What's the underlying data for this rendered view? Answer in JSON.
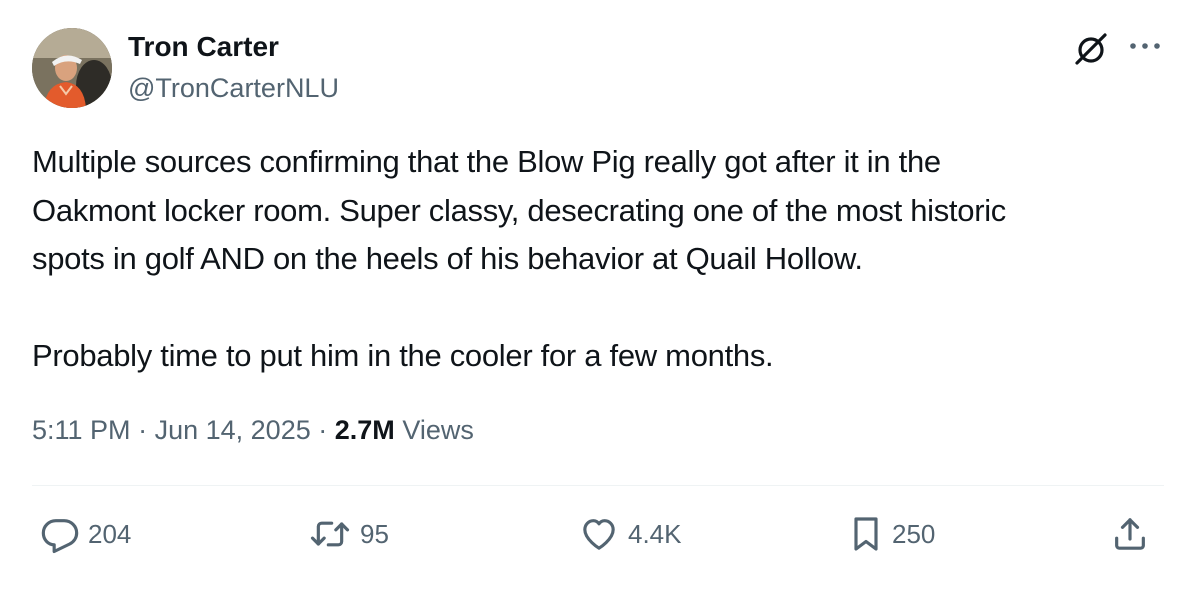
{
  "author": {
    "display_name": "Tron Carter",
    "handle": "@TronCarterNLU",
    "avatar_icon": "profile-photo-golfer"
  },
  "header_icons": {
    "grok": "grok-icon",
    "more": "more-options-icon"
  },
  "tweet": {
    "lines": [
      "Multiple sources confirming that the Blow Pig really got after it in the",
      "Oakmont locker room. Super classy, desecrating one of the most historic",
      "spots in golf AND on the heels of his behavior at Quail Hollow.",
      "Probably time to put him in the cooler for a few months."
    ]
  },
  "meta": {
    "time": "5:11 PM",
    "separator": "·",
    "date": "Jun 14, 2025",
    "views_count": "2.7M",
    "views_label": "Views"
  },
  "actions": {
    "replies": "204",
    "reposts": "95",
    "likes": "4.4K",
    "bookmarks": "250"
  },
  "colors": {
    "text_primary": "#0f1419",
    "text_secondary": "#536471",
    "divider": "#eff3f4",
    "background": "#ffffff"
  }
}
